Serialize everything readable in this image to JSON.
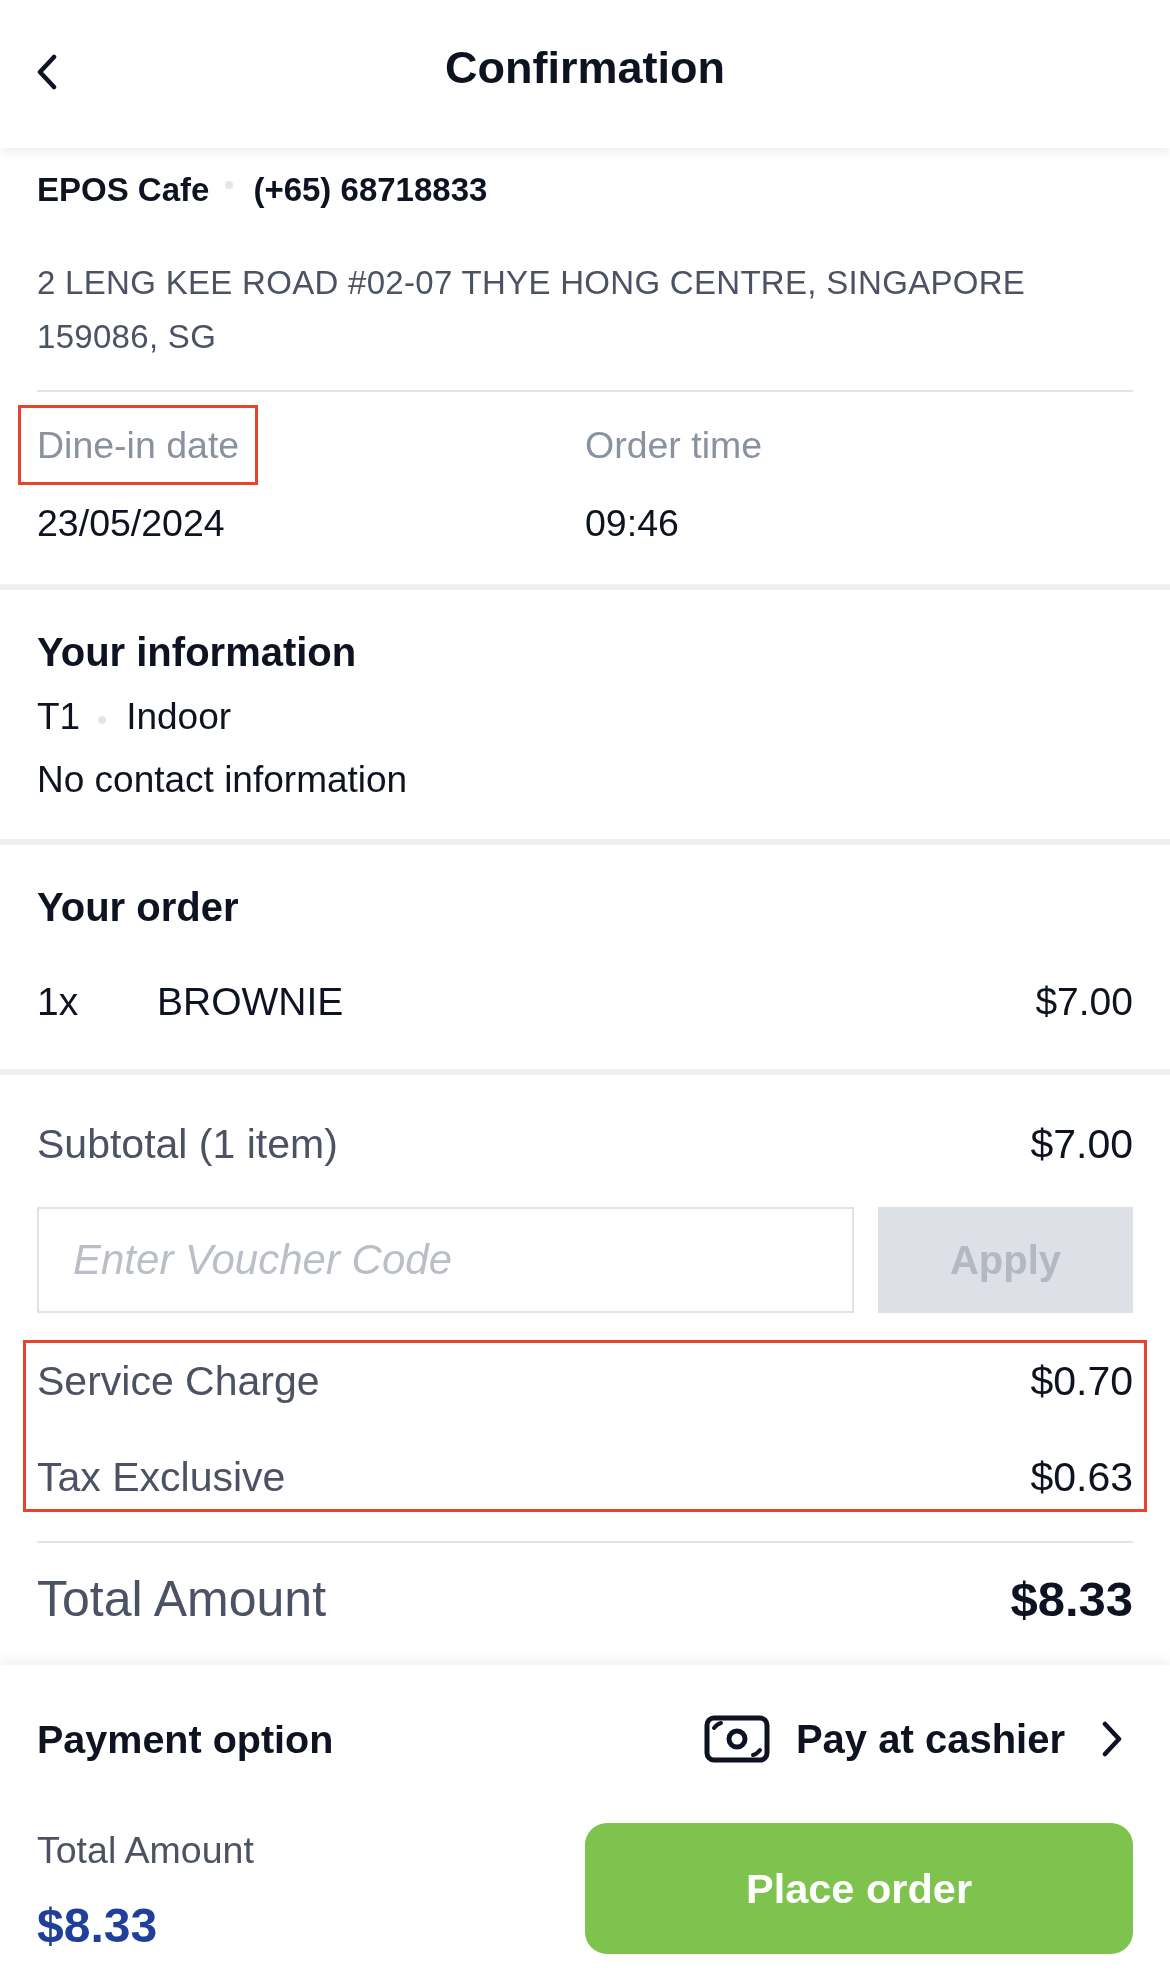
{
  "header": {
    "title": "Confirmation"
  },
  "venue": {
    "name": "EPOS Cafe",
    "phone": "(+65) 68718833",
    "address": "2 LENG KEE ROAD #02-07 THYE HONG CENTRE, SINGAPORE 159086, SG"
  },
  "order_details": [
    {
      "label": "Dine-in date",
      "value": "23/05/2024",
      "highlighted": true
    },
    {
      "label": "Order time",
      "value": "09:46",
      "highlighted": false
    }
  ],
  "your_information": {
    "title": "Your information",
    "table": "T1",
    "seating": "Indoor",
    "contact": "No contact information"
  },
  "your_order": {
    "title": "Your order",
    "items": [
      {
        "quantity": "1x",
        "name": "BROWNIE",
        "price": "$7.00"
      }
    ]
  },
  "summary": {
    "subtotal": {
      "label": "Subtotal (1 item)",
      "value": "$7.00"
    },
    "voucher": {
      "placeholder": "Enter Voucher Code",
      "apply_button": {
        "label": "Apply",
        "disabled": true
      }
    },
    "charges": {
      "highlighted": true,
      "rows": [
        {
          "label": "Service Charge",
          "value": "$0.70"
        },
        {
          "label": "Tax Exclusive",
          "value": "$0.63"
        }
      ]
    },
    "total": {
      "label": "Total Amount",
      "value": "$8.33"
    }
  },
  "payment": {
    "title": "Payment option",
    "method": "Pay at cashier"
  },
  "footer": {
    "total_label": "Total Amount",
    "total_value": "$8.33",
    "place_order_button": "Place order"
  }
}
